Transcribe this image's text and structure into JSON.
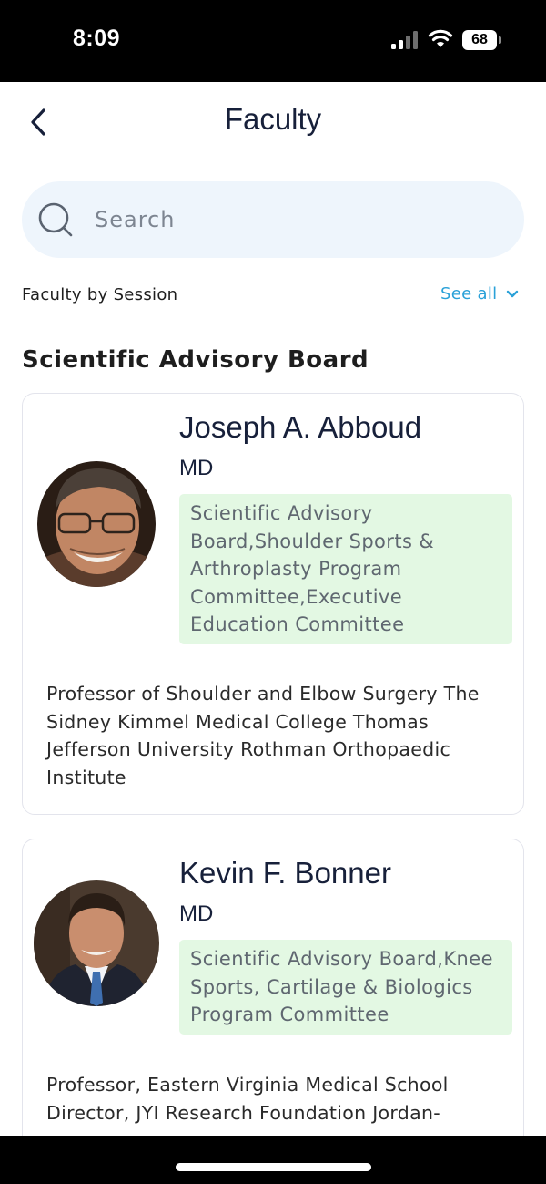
{
  "status_bar": {
    "time": "8:09",
    "battery": "68",
    "icons": [
      "cellular-signal-icon",
      "wifi-icon",
      "battery-icon"
    ]
  },
  "header": {
    "title": "Faculty",
    "back_icon": "chevron-left-icon"
  },
  "search": {
    "placeholder": "Search",
    "value": "",
    "icon": "search-icon"
  },
  "filter": {
    "label": "Faculty by Session",
    "see_all_label": "See all",
    "see_all_icon": "chevron-down-icon"
  },
  "group": {
    "heading": "Scientific Advisory Board"
  },
  "faculty": [
    {
      "name": "Joseph A. Abboud",
      "degree": "MD",
      "committees": "Scientific Advisory Board,Shoulder Sports & Arthroplasty Program Committee,Executive Education Committee",
      "affiliation": "Professor of Shoulder and Elbow Surgery The Sidney Kimmel Medical College Thomas Jefferson University Rothman Orthopaedic Institute",
      "photo": "avatar-photo"
    },
    {
      "name": "Kevin F. Bonner",
      "degree": "MD",
      "committees": "Scientific Advisory Board,Knee Sports, Cartilage & Biologics Program Committee",
      "affiliation": "Professor, Eastern Virginia Medical School Director, JYI Research Foundation Jordan-",
      "photo": "avatar-photo"
    }
  ],
  "colors": {
    "title_text": "#17203a",
    "accent_link": "#2aa1d8",
    "search_background": "#eef5fc",
    "tag_background": "#e3f8e3",
    "tag_text": "#5f6770",
    "card_border": "#e3e4ec"
  }
}
